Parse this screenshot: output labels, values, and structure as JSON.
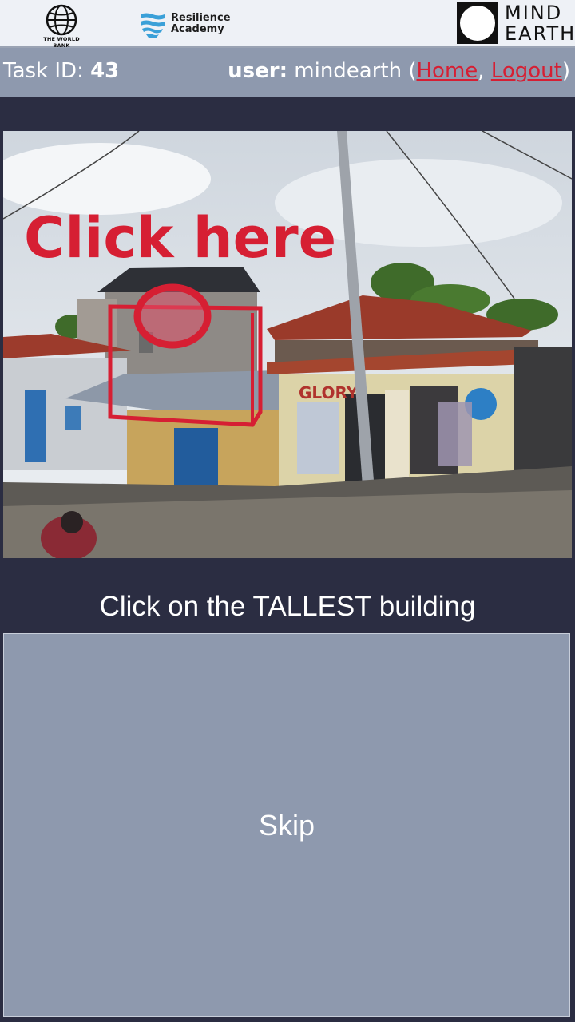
{
  "header": {
    "worldbank_text": "THE WORLD BANK",
    "resilience_text": "Resilience\nAcademy",
    "mindearth_text": "MIND\nEARTH"
  },
  "infobar": {
    "task_label": "Task ID: ",
    "task_id": "43",
    "user_label": "user:",
    "username": " mindearth (",
    "home_link": "Home",
    "separator": ", ",
    "logout_link": "Logout",
    "close_paren": ")"
  },
  "photo": {
    "overlay_text": "Click here",
    "shop_sign": "GLORY"
  },
  "instruction": "Click on the TALLEST building",
  "skip_label": "Skip",
  "colors": {
    "background": "#2b2d42",
    "bar": "#8e99ae",
    "accent_red": "#d61f33"
  }
}
